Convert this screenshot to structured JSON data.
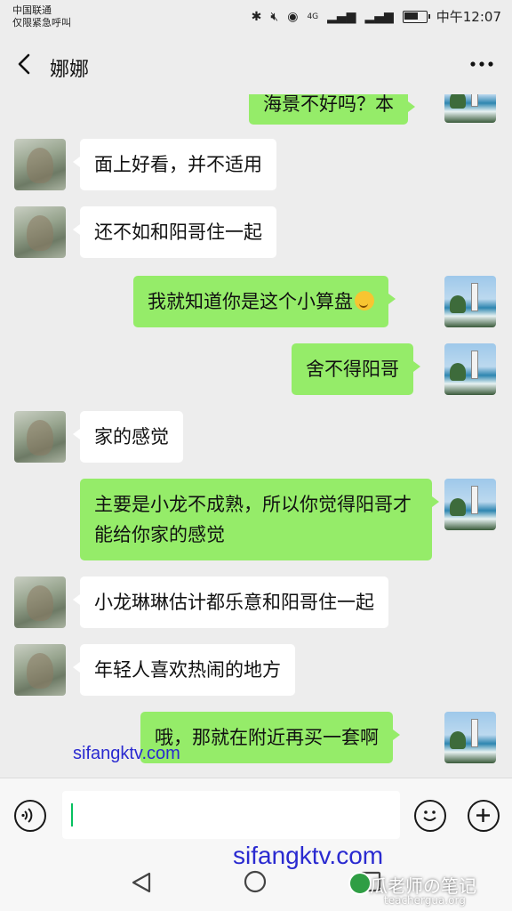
{
  "status_bar": {
    "carrier": "中国联通",
    "emergency": "仅限紧急呼叫",
    "network": "4G",
    "time": "中午12:07"
  },
  "header": {
    "title": "娜娜"
  },
  "messages": [
    {
      "side": "out",
      "text": "海景不好吗？本"
    },
    {
      "side": "in",
      "text": "面上好看，并不适用"
    },
    {
      "side": "in",
      "text": "还不如和阳哥住一起"
    },
    {
      "side": "out",
      "text": "我就知道你是这个小算盘"
    },
    {
      "side": "out",
      "text": "舍不得阳哥"
    },
    {
      "side": "in",
      "text": "家的感觉"
    },
    {
      "side": "out",
      "text": "主要是小龙不成熟，所以你觉得阳哥才能给你家的感觉"
    },
    {
      "side": "in",
      "text": "小龙琳琳估计都乐意和阳哥住一起"
    },
    {
      "side": "in",
      "text": "年轻人喜欢热闹的地方"
    },
    {
      "side": "out",
      "text": "哦，那就在附近再买一套啊"
    }
  ],
  "watermarks": {
    "site1": "sifangktv.com",
    "site2": "sifangktv.com",
    "brand": "瓜老师の笔记",
    "brand_url": "teachergua.org"
  },
  "colors": {
    "outgoing_bubble": "#95ec69",
    "incoming_bubble": "#ffffff",
    "background": "#ededed"
  },
  "battery_level": 0.7
}
